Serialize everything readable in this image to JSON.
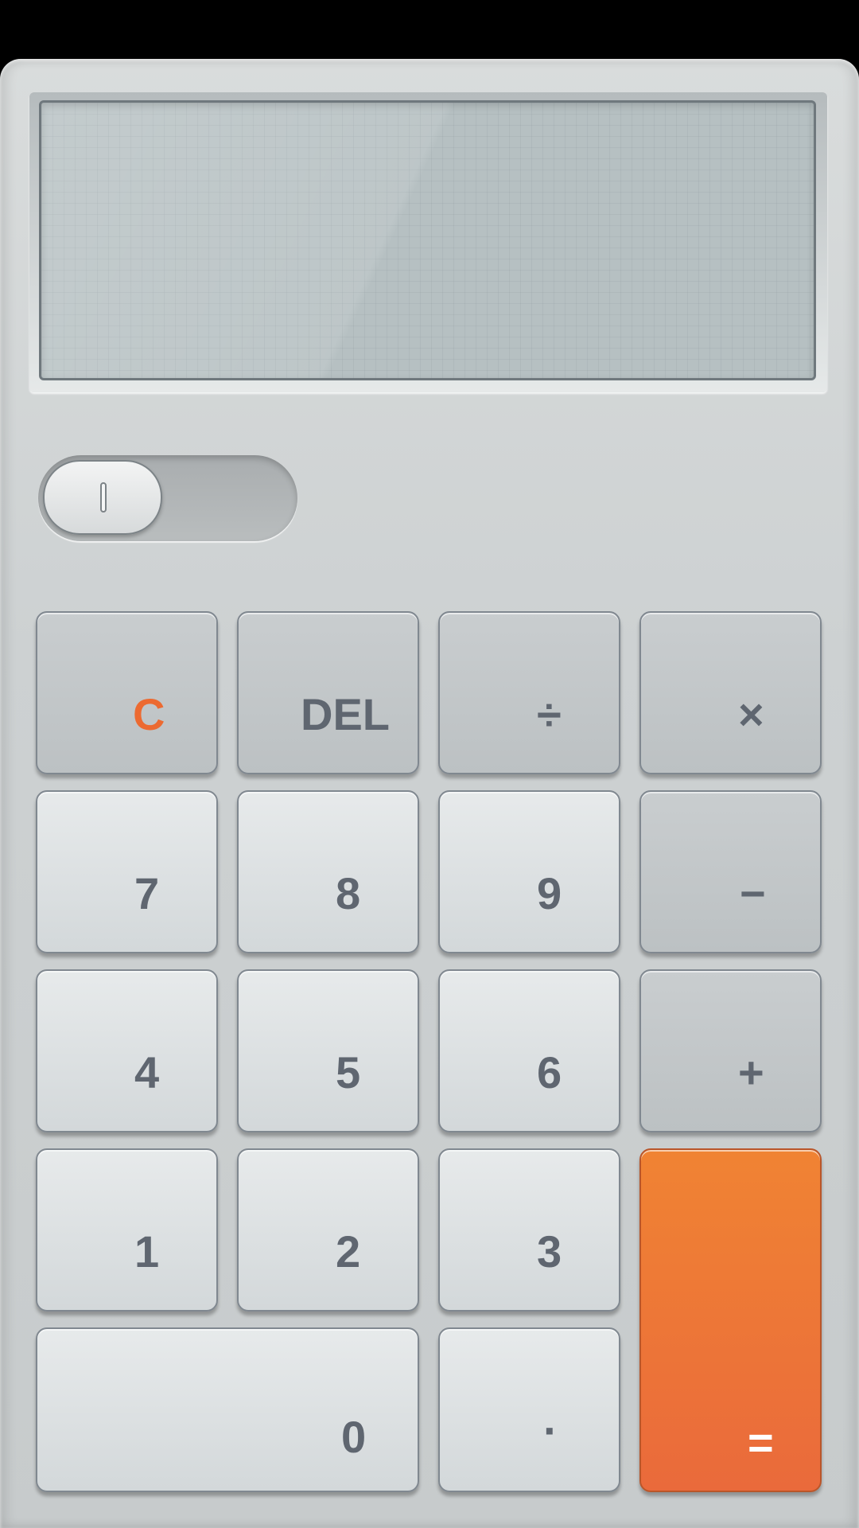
{
  "display": {
    "value": ""
  },
  "mode_toggle": {
    "state": "off"
  },
  "keys": {
    "clear": "C",
    "delete": "DEL",
    "divide": "÷",
    "multiply": "×",
    "seven": "7",
    "eight": "8",
    "nine": "9",
    "minus": "−",
    "four": "4",
    "five": "5",
    "six": "6",
    "plus": "+",
    "one": "1",
    "two": "2",
    "three": "3",
    "equals": "=",
    "zero": "0",
    "decimal": "·"
  },
  "colors": {
    "accent": "#ec6a31",
    "equals_key": "#ee7733",
    "key_text": "#5f6670",
    "display_bg": "#b6c0c2"
  }
}
